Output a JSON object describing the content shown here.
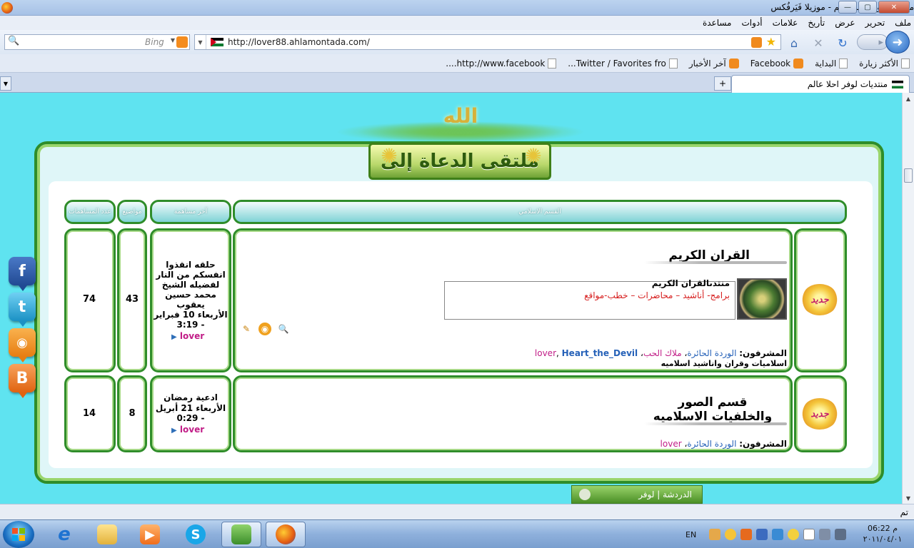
{
  "window": {
    "title": "منتديات لوفر احلا عالم - موزيلا فَيَرفُكس",
    "buttons": {
      "minimize": "—",
      "maximize": "▢",
      "close": "✕"
    }
  },
  "menu": [
    "ملف",
    "تحرير",
    "عرض",
    "تأريخ",
    "علامات",
    "أدوات",
    "مساعدة"
  ],
  "nav": {
    "url": "http://lover88.ahlamontada.com/",
    "search_placeholder": "Bing",
    "back_icon": "arrow-left-icon",
    "forward_icon": "arrow-right-icon"
  },
  "bookmarks": [
    {
      "label": "الأكثر زيارة",
      "icon": "page"
    },
    {
      "label": "البداية",
      "icon": "page"
    },
    {
      "label": "Facebook",
      "icon": "rss"
    },
    {
      "label": "آخر الأخبار",
      "icon": "rss"
    },
    {
      "label": "Twitter / Favorites fro...",
      "icon": "page"
    },
    {
      "label": "http://www.facebook....",
      "icon": "page"
    }
  ],
  "tab": {
    "label": "منتديات لوفر احلا عالم",
    "new_tab": "+"
  },
  "page": {
    "banner": "ملتقى الدعاة إلى",
    "banner_top": "الله",
    "headers": {
      "section": "القسم الاسلامي",
      "last_post": "آخر مساهمة",
      "topics": "مواضيع",
      "posts": "عدد المساهمات"
    },
    "new_badge": "جديد",
    "forums": [
      {
        "title": "القران الكريم",
        "sub_forum": "منتدىالقران الكريم",
        "sub_desc": "برامج- أناشيد – محاضرات – خطب-مواقع",
        "moderators_label": "المشرفون:",
        "moderators": [
          "الوردة الحائرة",
          "ملاك الحب",
          "lover",
          "Heart_the_Devil"
        ],
        "description": "اسلاميات وقران واناشيد اسلاميه",
        "last_post_title": "حلقه انقذوا انفسكم من النار لفضيله الشيخ محمد حسين يعقوب",
        "last_post_date": "الأربعاء 10 فبراير - 3:19",
        "last_post_user": "lover",
        "topics": "43",
        "posts": "74"
      },
      {
        "title": "قسم الصور والخلفيات الاسلاميه",
        "moderators_label": "المشرفون:",
        "moderators": [
          "الوردة الحائرة",
          "lover"
        ],
        "last_post_title": "ادعية رمضان",
        "last_post_date": "الأربعاء 21 أبريل - 0:29",
        "last_post_user": "lover",
        "topics": "8",
        "posts": "14"
      }
    ],
    "social": [
      "f",
      "t",
      "rss",
      "B"
    ],
    "chat_label": "الدردشة | لوفر"
  },
  "status": "تم",
  "taskbar": {
    "lang": "EN",
    "time": "06:22 م",
    "date": "٢٠١١/٠٤/٠١"
  }
}
